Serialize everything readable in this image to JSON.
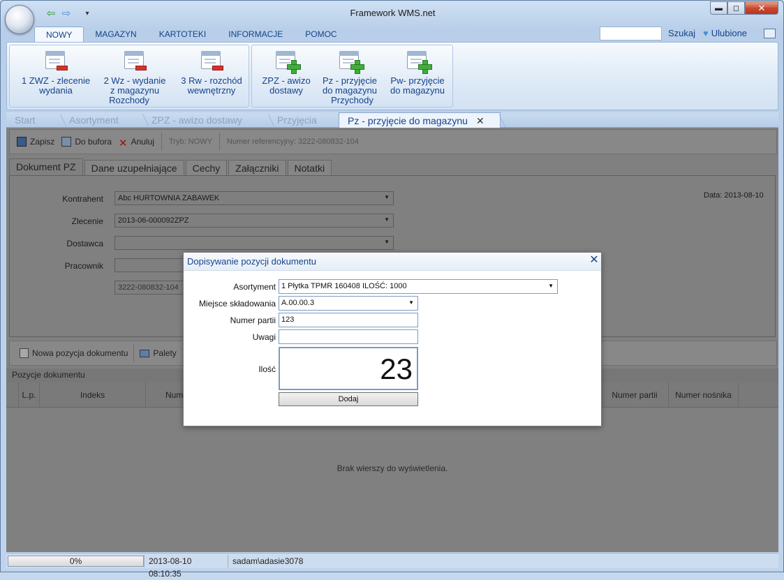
{
  "app": {
    "title": "Framework WMS.net"
  },
  "window_buttons": {
    "minimize": "▬",
    "maximize": "◻",
    "close": "✕"
  },
  "ribbon_tabs": [
    "NOWY",
    "MAGAZYN",
    "KARTOTEKI",
    "INFORMACJE",
    "POMOC"
  ],
  "search": {
    "label": "Szukaj",
    "placeholder": ""
  },
  "favorites": {
    "label": "Ulubione"
  },
  "ribbon": {
    "rozchody": {
      "label": "Rozchody",
      "items": [
        {
          "line1": "1 ZWZ - zlecenie",
          "line2": "wydania"
        },
        {
          "line1": "2 Wz - wydanie",
          "line2": "z magazynu"
        },
        {
          "line1": "3 Rw - rozchód",
          "line2": "wewnętrzny"
        }
      ]
    },
    "przychody": {
      "label": "Przychody",
      "items": [
        {
          "line1": "ZPZ - awizo",
          "line2": "dostawy"
        },
        {
          "line1": "Pz - przyjęcie",
          "line2": "do magazynu"
        },
        {
          "line1": "Pw- przyjęcie",
          "line2": "do magazynu"
        }
      ]
    }
  },
  "doc_tabs": [
    "Start",
    "Asortyment",
    "ZPZ - awizo dostawy",
    "Przyjęcia",
    "Pz - przyjęcie do magazynu"
  ],
  "doc_tab_close": "✕",
  "toolbar": {
    "save": "Zapisz",
    "buffer": "Do bufora",
    "cancel": "Anuluj",
    "mode": "Tryb: NOWY",
    "ref": "Numer referencyjny: 3222-080832-104"
  },
  "form_tabs": [
    "Dokument PZ",
    "Dane uzupełniające",
    "Cechy",
    "Załączniki",
    "Notatki"
  ],
  "form": {
    "kontrahent_label": "Kontrahent",
    "kontrahent_value": "Abc HURTOWNIA ZABAWEK",
    "zlecenie_label": "Zlecenie",
    "zlecenie_value": "2013-06-000092ZPZ",
    "dostawca_label": "Dostawca",
    "dostawca_value": "",
    "pracownik_label": "Pracownik",
    "pracownik_value": "",
    "ref_value": "3222-080832-104",
    "date": "Data: 2013-08-10"
  },
  "positions_toolbar": {
    "new": "Nowa pozycja dokumentu",
    "pallets": "Palety"
  },
  "positions": {
    "title": "Pozycje dokumentu",
    "columns": [
      "L.p.",
      "Indeks",
      "Num",
      "Numer partii",
      "Numer nośnika"
    ],
    "empty": "Brak wierszy do wyświetlenia."
  },
  "status": {
    "progress": "0%",
    "datetime": "2013-08-10 08:10:35",
    "user": "sadam\\adasie3078"
  },
  "dialog": {
    "title": "Dopisywanie pozycji dokumentu",
    "close": "✕",
    "asortyment_label": "Asortyment",
    "asortyment_value": "1 Płytka TPMR 160408 ILOŚĆ: 1000",
    "miejsce_label": "Miejsce składowania",
    "miejsce_value": "A.00.00.3",
    "partia_label": "Numer partii",
    "partia_value": "123",
    "uwagi_label": "Uwagi",
    "uwagi_value": "",
    "ilosc_label": "Ilość",
    "ilosc_value": "23",
    "add_button": "Dodaj"
  }
}
